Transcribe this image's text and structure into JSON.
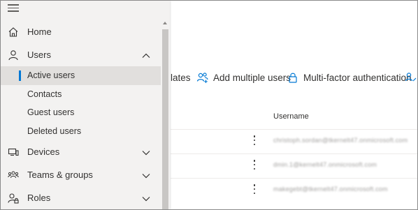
{
  "nav": {
    "menu_icon": "hamburger-icon",
    "items": [
      {
        "label": "Home",
        "icon": "home-icon"
      },
      {
        "label": "Users",
        "icon": "person-icon",
        "expanded": true
      },
      {
        "label": "Devices",
        "icon": "devices-icon"
      },
      {
        "label": "Teams & groups",
        "icon": "people-group-icon"
      },
      {
        "label": "Roles",
        "icon": "roles-icon"
      }
    ],
    "users_subitems": [
      {
        "label": "Active users",
        "active": true
      },
      {
        "label": "Contacts"
      },
      {
        "label": "Guest users"
      },
      {
        "label": "Deleted users"
      }
    ]
  },
  "toolbar": {
    "templates_label": "lates",
    "add_multiple_label": "Add multiple users",
    "mfa_label": "Multi-factor authentication"
  },
  "table": {
    "username_header": "Username",
    "rows": [
      {
        "username": "christoph.sordan@tkernelt47.onmicrosoft.com"
      },
      {
        "username": "dmin.1@kernelt47.onmicrosoft.com"
      },
      {
        "username": "makegebt@tkernelt47.onmicrosoft.com"
      }
    ]
  },
  "colors": {
    "accent": "#0078d4",
    "nav_bg": "#f3f2f1",
    "active_bg": "#e1dfdd"
  }
}
